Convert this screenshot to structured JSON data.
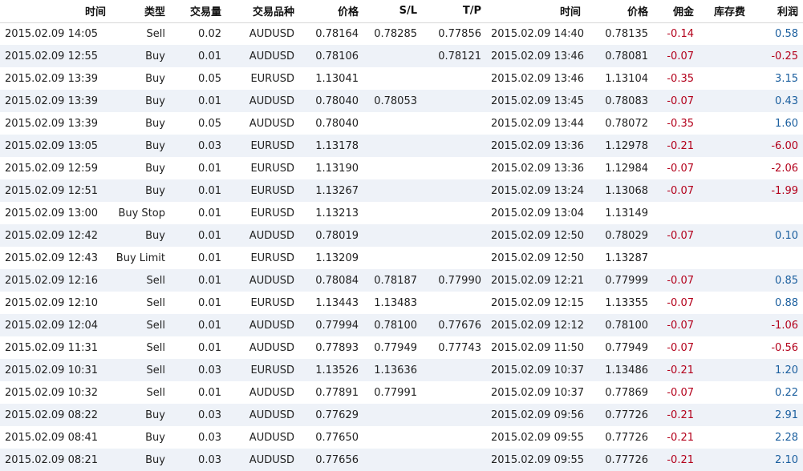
{
  "headers": [
    "时间",
    "类型",
    "交易量",
    "交易品种",
    "价格",
    "S/L",
    "T/P",
    "时间",
    "价格",
    "佣金",
    "库存费",
    "利润"
  ],
  "colors": {
    "negative": "#b3001b",
    "positive": "#1a5e9e",
    "row_alt": "#eef2f8"
  },
  "rows": [
    [
      "2015.02.09 14:05",
      "Sell",
      "0.02",
      "AUDUSD",
      "0.78164",
      "0.78285",
      "0.77856",
      "2015.02.09 14:40",
      "0.78135",
      "-0.14",
      "",
      "0.58"
    ],
    [
      "2015.02.09 12:55",
      "Buy",
      "0.01",
      "AUDUSD",
      "0.78106",
      "",
      "0.78121",
      "2015.02.09 13:46",
      "0.78081",
      "-0.07",
      "",
      "-0.25"
    ],
    [
      "2015.02.09 13:39",
      "Buy",
      "0.05",
      "EURUSD",
      "1.13041",
      "",
      "",
      "2015.02.09 13:46",
      "1.13104",
      "-0.35",
      "",
      "3.15"
    ],
    [
      "2015.02.09 13:39",
      "Buy",
      "0.01",
      "AUDUSD",
      "0.78040",
      "0.78053",
      "",
      "2015.02.09 13:45",
      "0.78083",
      "-0.07",
      "",
      "0.43"
    ],
    [
      "2015.02.09 13:39",
      "Buy",
      "0.05",
      "AUDUSD",
      "0.78040",
      "",
      "",
      "2015.02.09 13:44",
      "0.78072",
      "-0.35",
      "",
      "1.60"
    ],
    [
      "2015.02.09 13:05",
      "Buy",
      "0.03",
      "EURUSD",
      "1.13178",
      "",
      "",
      "2015.02.09 13:36",
      "1.12978",
      "-0.21",
      "",
      "-6.00"
    ],
    [
      "2015.02.09 12:59",
      "Buy",
      "0.01",
      "EURUSD",
      "1.13190",
      "",
      "",
      "2015.02.09 13:36",
      "1.12984",
      "-0.07",
      "",
      "-2.06"
    ],
    [
      "2015.02.09 12:51",
      "Buy",
      "0.01",
      "EURUSD",
      "1.13267",
      "",
      "",
      "2015.02.09 13:24",
      "1.13068",
      "-0.07",
      "",
      "-1.99"
    ],
    [
      "2015.02.09 13:00",
      "Buy Stop",
      "0.01",
      "EURUSD",
      "1.13213",
      "",
      "",
      "2015.02.09 13:04",
      "1.13149",
      "",
      "",
      ""
    ],
    [
      "2015.02.09 12:42",
      "Buy",
      "0.01",
      "AUDUSD",
      "0.78019",
      "",
      "",
      "2015.02.09 12:50",
      "0.78029",
      "-0.07",
      "",
      "0.10"
    ],
    [
      "2015.02.09 12:43",
      "Buy Limit",
      "0.01",
      "EURUSD",
      "1.13209",
      "",
      "",
      "2015.02.09 12:50",
      "1.13287",
      "",
      "",
      ""
    ],
    [
      "2015.02.09 12:16",
      "Sell",
      "0.01",
      "AUDUSD",
      "0.78084",
      "0.78187",
      "0.77990",
      "2015.02.09 12:21",
      "0.77999",
      "-0.07",
      "",
      "0.85"
    ],
    [
      "2015.02.09 12:10",
      "Sell",
      "0.01",
      "EURUSD",
      "1.13443",
      "1.13483",
      "",
      "2015.02.09 12:15",
      "1.13355",
      "-0.07",
      "",
      "0.88"
    ],
    [
      "2015.02.09 12:04",
      "Sell",
      "0.01",
      "AUDUSD",
      "0.77994",
      "0.78100",
      "0.77676",
      "2015.02.09 12:12",
      "0.78100",
      "-0.07",
      "",
      "-1.06"
    ],
    [
      "2015.02.09 11:31",
      "Sell",
      "0.01",
      "AUDUSD",
      "0.77893",
      "0.77949",
      "0.77743",
      "2015.02.09 11:50",
      "0.77949",
      "-0.07",
      "",
      "-0.56"
    ],
    [
      "2015.02.09 10:31",
      "Sell",
      "0.03",
      "EURUSD",
      "1.13526",
      "1.13636",
      "",
      "2015.02.09 10:37",
      "1.13486",
      "-0.21",
      "",
      "1.20"
    ],
    [
      "2015.02.09 10:32",
      "Sell",
      "0.01",
      "AUDUSD",
      "0.77891",
      "0.77991",
      "",
      "2015.02.09 10:37",
      "0.77869",
      "-0.07",
      "",
      "0.22"
    ],
    [
      "2015.02.09 08:22",
      "Buy",
      "0.03",
      "AUDUSD",
      "0.77629",
      "",
      "",
      "2015.02.09 09:56",
      "0.77726",
      "-0.21",
      "",
      "2.91"
    ],
    [
      "2015.02.09 08:41",
      "Buy",
      "0.03",
      "AUDUSD",
      "0.77650",
      "",
      "",
      "2015.02.09 09:55",
      "0.77726",
      "-0.21",
      "",
      "2.28"
    ],
    [
      "2015.02.09 08:21",
      "Buy",
      "0.03",
      "AUDUSD",
      "0.77656",
      "",
      "",
      "2015.02.09 09:55",
      "0.77726",
      "-0.21",
      "",
      "2.10"
    ]
  ]
}
